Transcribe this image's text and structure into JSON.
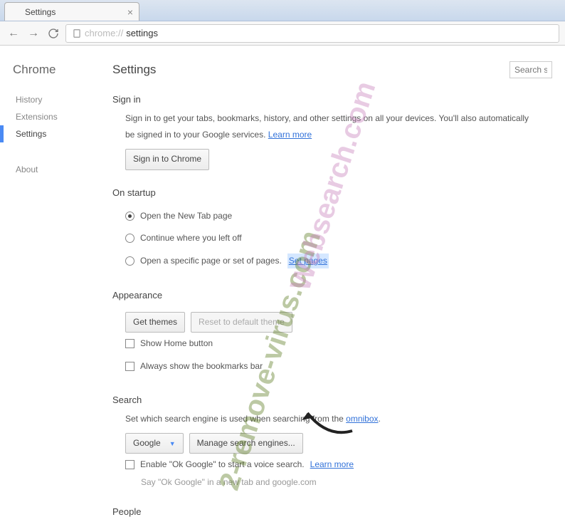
{
  "tab": {
    "title": "Settings"
  },
  "address": {
    "prefix": "chrome://",
    "suffix": "settings"
  },
  "sidebar": {
    "title": "Chrome",
    "items": [
      "History",
      "Extensions",
      "Settings"
    ],
    "about": "About",
    "active_index": 2
  },
  "header": {
    "title": "Settings",
    "search_placeholder": "Search settings"
  },
  "signin": {
    "title": "Sign in",
    "desc1": "Sign in to get your tabs, bookmarks, history, and other settings on all your devices. You'll also automatically",
    "desc2": "be signed in to your Google services.",
    "learn_more": "Learn more",
    "button": "Sign in to Chrome"
  },
  "startup": {
    "title": "On startup",
    "options": [
      {
        "label": "Open the New Tab page",
        "checked": true
      },
      {
        "label": "Continue where you left off",
        "checked": false
      },
      {
        "label": "Open a specific page or set of pages.",
        "checked": false,
        "link": "Set pages"
      }
    ]
  },
  "appearance": {
    "title": "Appearance",
    "get_themes": "Get themes",
    "reset_theme": "Reset to default theme",
    "show_home": "Show Home button",
    "show_bookmarks": "Always show the bookmarks bar"
  },
  "search": {
    "title": "Search",
    "desc_pre": "Set which search engine is used when searching from the ",
    "omnibox_link": "omnibox",
    "engine": "Google",
    "manage": "Manage search engines...",
    "enable_ok_pre": "Enable \"Ok Google\" to start a voice search. ",
    "ok_learn": "Learn more",
    "hint": "Say \"Ok Google\" in a new tab and google.com"
  },
  "people": {
    "title": "People"
  },
  "watermarks": {
    "w1": "2-remove-virus.com",
    "w2": "Websearch.com"
  }
}
